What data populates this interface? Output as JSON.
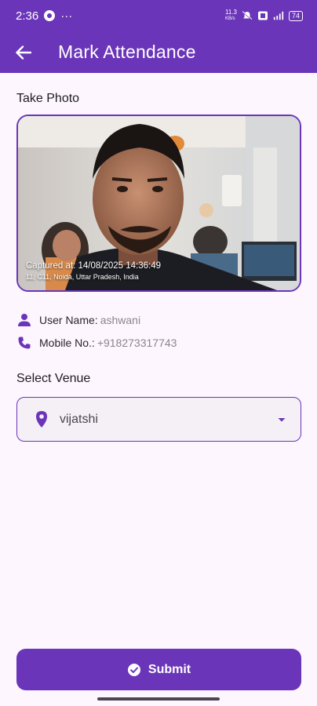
{
  "status_bar": {
    "time": "2:36",
    "network_speed": "11.3",
    "network_unit": "KB/s",
    "battery": "74"
  },
  "app_bar": {
    "title": "Mark Attendance"
  },
  "photo_section": {
    "label": "Take Photo",
    "captured_text": "Captured at: 14/08/2025 14:36:49",
    "location_text": "11, C11, Noida, Uttar Pradesh, India"
  },
  "user_info": {
    "username_label": "User Name:",
    "username_value": "ashwani",
    "mobile_label": "Mobile No.:",
    "mobile_value": "+918273317743"
  },
  "venue": {
    "label": "Select Venue",
    "selected": "vijatshi"
  },
  "submit": {
    "label": "Submit"
  },
  "colors": {
    "primary": "#6a35b8",
    "background": "#fdf6ff"
  }
}
